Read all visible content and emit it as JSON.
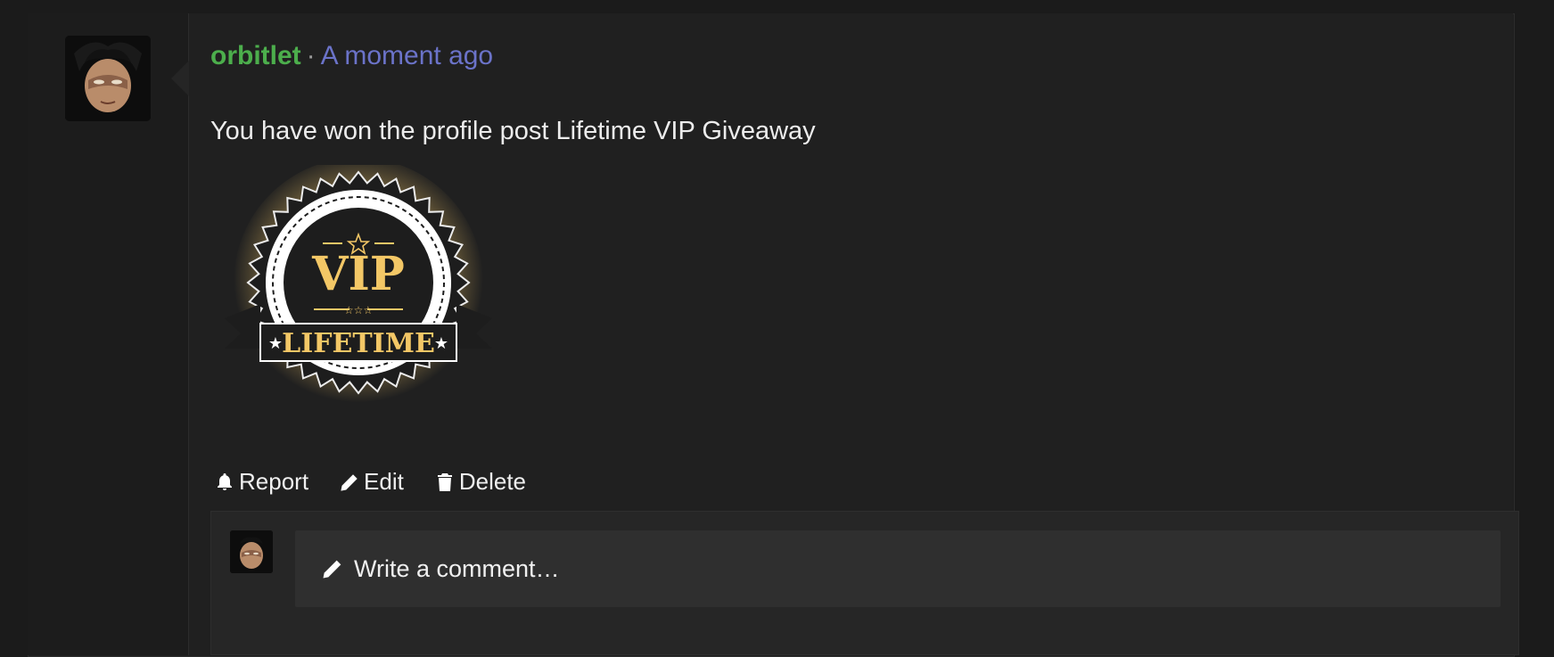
{
  "post": {
    "username": "orbitlet",
    "separator": "·",
    "timestamp": "A moment ago",
    "message": "You have won the profile post Lifetime VIP Giveaway"
  },
  "badge": {
    "top_text": "VIP",
    "ribbon_text": "LIFETIME",
    "colors": {
      "gold": "#f3c766",
      "dark": "#1b1b1b",
      "white": "#ffffff"
    }
  },
  "actions": {
    "report": "Report",
    "edit": "Edit",
    "delete": "Delete"
  },
  "comment": {
    "placeholder": "Write a comment…"
  },
  "colors": {
    "username": "#4cae4c",
    "timestamp": "#6b73c9",
    "background": "#1f1f1f"
  },
  "icons": [
    "bell-icon",
    "pencil-icon",
    "trash-icon"
  ]
}
